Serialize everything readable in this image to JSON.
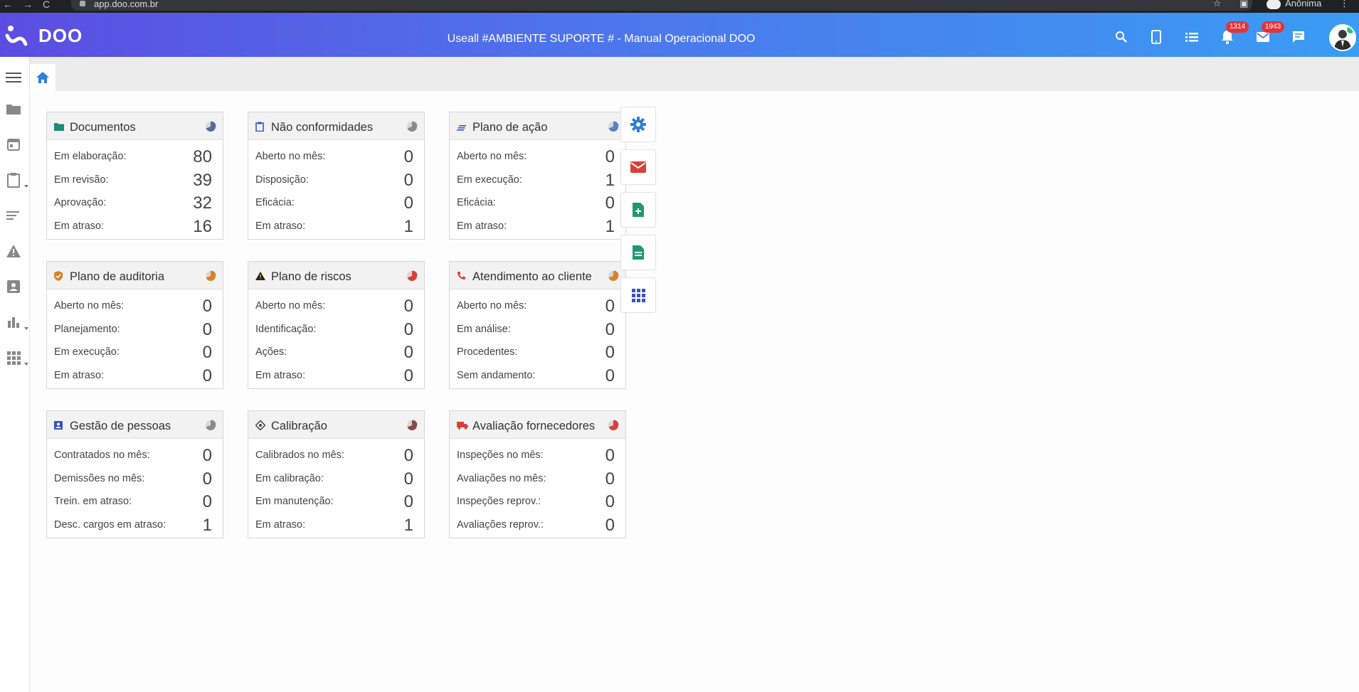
{
  "browser": {
    "url": "app.doo.com.br",
    "profile": "Anônima"
  },
  "header": {
    "logo_text": "DOO",
    "title": "Useall #AMBIENTE SUPORTE # - Manual Operacional DOO",
    "notifications_count": "1314",
    "messages_count": "1943"
  },
  "sidebar": {
    "items": [
      "menu-icon",
      "folder-icon",
      "calendar-icon",
      "clipboard-icon",
      "list-icon",
      "warning-icon",
      "contact-card-icon",
      "bar-chart-icon",
      "apps-icon"
    ]
  },
  "tabs": {
    "home": "home-icon"
  },
  "colors": {
    "header_start": "#5b4de1",
    "header_end": "#3a9cf3",
    "badge": "#e0353a"
  },
  "cards": [
    {
      "id": "documentos",
      "title": "Documentos",
      "icon": "folder-icon",
      "icon_color": "#1f8a6e",
      "pie_color": "#5a6b9a",
      "rows": [
        {
          "label": "Em elaboração:",
          "value": "80"
        },
        {
          "label": "Em revisão:",
          "value": "39"
        },
        {
          "label": "Aprovação:",
          "value": "32"
        },
        {
          "label": "Em atraso:",
          "value": "16"
        }
      ]
    },
    {
      "id": "nao-conformidades",
      "title": "Não conformidades",
      "icon": "clipboard-icon",
      "icon_color": "#3b4fc4",
      "pie_color": "#8a8a8a",
      "rows": [
        {
          "label": "Aberto no mês:",
          "value": "0"
        },
        {
          "label": "Disposição:",
          "value": "0"
        },
        {
          "label": "Eficácia:",
          "value": "0"
        },
        {
          "label": "Em atraso:",
          "value": "1"
        }
      ]
    },
    {
      "id": "plano-acao",
      "title": "Plano de ação",
      "icon": "list-icon",
      "icon_color": "#3b4fc4",
      "pie_color": "#5b7fc4",
      "rows": [
        {
          "label": "Aberto no mês:",
          "value": "0"
        },
        {
          "label": "Em execução:",
          "value": "1"
        },
        {
          "label": "Eficácia:",
          "value": "0"
        },
        {
          "label": "Em atraso:",
          "value": "1"
        }
      ]
    },
    {
      "id": "plano-auditoria",
      "title": "Plano de auditoria",
      "icon": "shield-check-icon",
      "icon_color": "#d9822b",
      "pie_color": "#d9822b",
      "rows": [
        {
          "label": "Aberto no mês:",
          "value": "0"
        },
        {
          "label": "Planejamento:",
          "value": "0"
        },
        {
          "label": "Em execução:",
          "value": "0"
        },
        {
          "label": "Em atraso:",
          "value": "0"
        }
      ]
    },
    {
      "id": "plano-riscos",
      "title": "Plano de riscos",
      "icon": "warning-icon",
      "icon_color": "#222222",
      "pie_color": "#d9403a",
      "rows": [
        {
          "label": "Aberto no mês:",
          "value": "0"
        },
        {
          "label": "Identificação:",
          "value": "0"
        },
        {
          "label": "Ações:",
          "value": "0"
        },
        {
          "label": "Em atraso:",
          "value": "0"
        }
      ]
    },
    {
      "id": "atendimento",
      "title": "Atendimento ao cliente",
      "icon": "phone-icon",
      "icon_color": "#d9403a",
      "pie_color": "#d9822b",
      "rows": [
        {
          "label": "Aberto no mês:",
          "value": "0"
        },
        {
          "label": "Em análise:",
          "value": "0"
        },
        {
          "label": "Procedentes:",
          "value": "0"
        },
        {
          "label": "Sem andamento:",
          "value": "0"
        }
      ]
    },
    {
      "id": "gestao-pessoas",
      "title": "Gestão de pessoas",
      "icon": "contact-card-icon",
      "icon_color": "#3b4fc4",
      "pie_color": "#8a8a8a",
      "rows": [
        {
          "label": "Contratados no mês:",
          "value": "0"
        },
        {
          "label": "Demissões no mês:",
          "value": "0"
        },
        {
          "label": "Trein. em atraso:",
          "value": "0"
        },
        {
          "label": "Desc. cargos em atraso:",
          "value": "1"
        }
      ]
    },
    {
      "id": "calibracao",
      "title": "Calibração",
      "icon": "target-icon",
      "icon_color": "#444444",
      "pie_color": "#8a4a4a",
      "rows": [
        {
          "label": "Calibrados no mês:",
          "value": "0"
        },
        {
          "label": "Em calibração:",
          "value": "0"
        },
        {
          "label": "Em manutenção:",
          "value": "0"
        },
        {
          "label": "Em atraso:",
          "value": "1"
        }
      ]
    },
    {
      "id": "avaliacao-fornecedores",
      "title": "Avaliação fornecedores",
      "icon": "truck-icon",
      "icon_color": "#d9403a",
      "pie_color": "#d9403a",
      "rows": [
        {
          "label": "Inspeções no mês:",
          "value": "0"
        },
        {
          "label": "Avaliações no mês:",
          "value": "0"
        },
        {
          "label": "Inspeções reprov.:",
          "value": "0"
        },
        {
          "label": "Avaliações reprov.:",
          "value": "0"
        }
      ]
    }
  ],
  "quick_actions": [
    "settings-icon",
    "email-icon",
    "add-document-icon",
    "document-icon",
    "apps-grid-icon"
  ]
}
